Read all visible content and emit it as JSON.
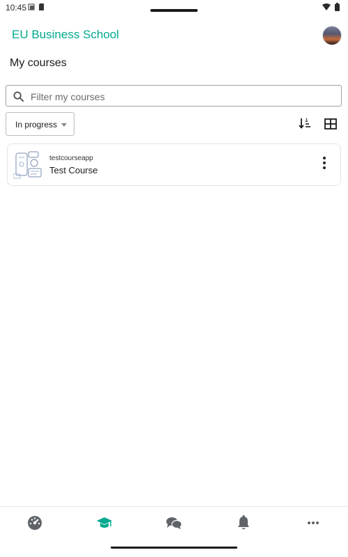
{
  "status_bar": {
    "time": "10:45"
  },
  "header": {
    "app_title": "EU Business School",
    "avatar_icon": "user-avatar"
  },
  "page": {
    "title": "My courses"
  },
  "search": {
    "placeholder": "Filter my courses",
    "value": ""
  },
  "filter": {
    "selected": "In progress"
  },
  "toolbar": {
    "sort_icon": "sort-icon",
    "view_icon": "grid-view-icon"
  },
  "courses": [
    {
      "category": "testcourseapp",
      "name": "Test Course"
    }
  ],
  "bottom_nav": {
    "items": [
      "dashboard",
      "my-courses",
      "messages",
      "notifications",
      "more"
    ],
    "active": "my-courses"
  },
  "colors": {
    "accent": "#00a98f",
    "icon": "#5f6368"
  }
}
